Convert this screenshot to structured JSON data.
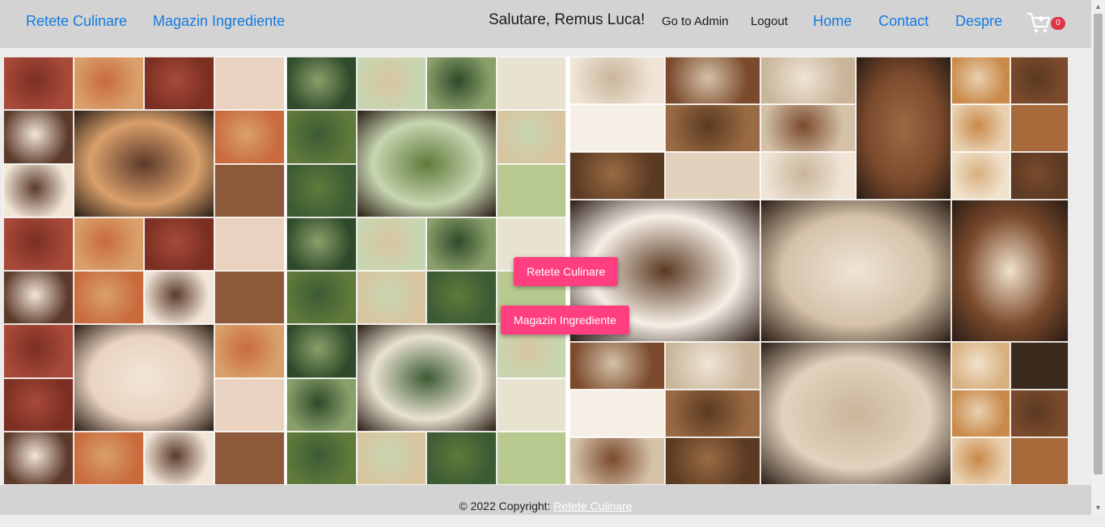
{
  "nav": {
    "brand_recipes": "Retete Culinare",
    "brand_shop": "Magazin Ingrediente",
    "greeting": "Salutare, Remus Luca!",
    "admin": "Go to Admin",
    "logout": "Logout",
    "home": "Home",
    "contact": "Contact",
    "about": "Despre",
    "cart_count": "0",
    "cart_icon": "shopping-cart-icon"
  },
  "hero": {
    "recipes_button": "Retete Culinare",
    "shop_button": "Magazin Ingrediente",
    "panels": [
      "meat-dishes-collage",
      "appetizers-collage",
      "cakes-collage",
      "pastries-and-main-dishes-collage"
    ]
  },
  "footer": {
    "copyright": "© 2022 Copyright:",
    "link": "Retete Culinare"
  },
  "colors": {
    "nav_bg": "#d3d3d3",
    "link": "#1479e0",
    "cta": "#ff3f7f",
    "badge": "#dc3545"
  }
}
